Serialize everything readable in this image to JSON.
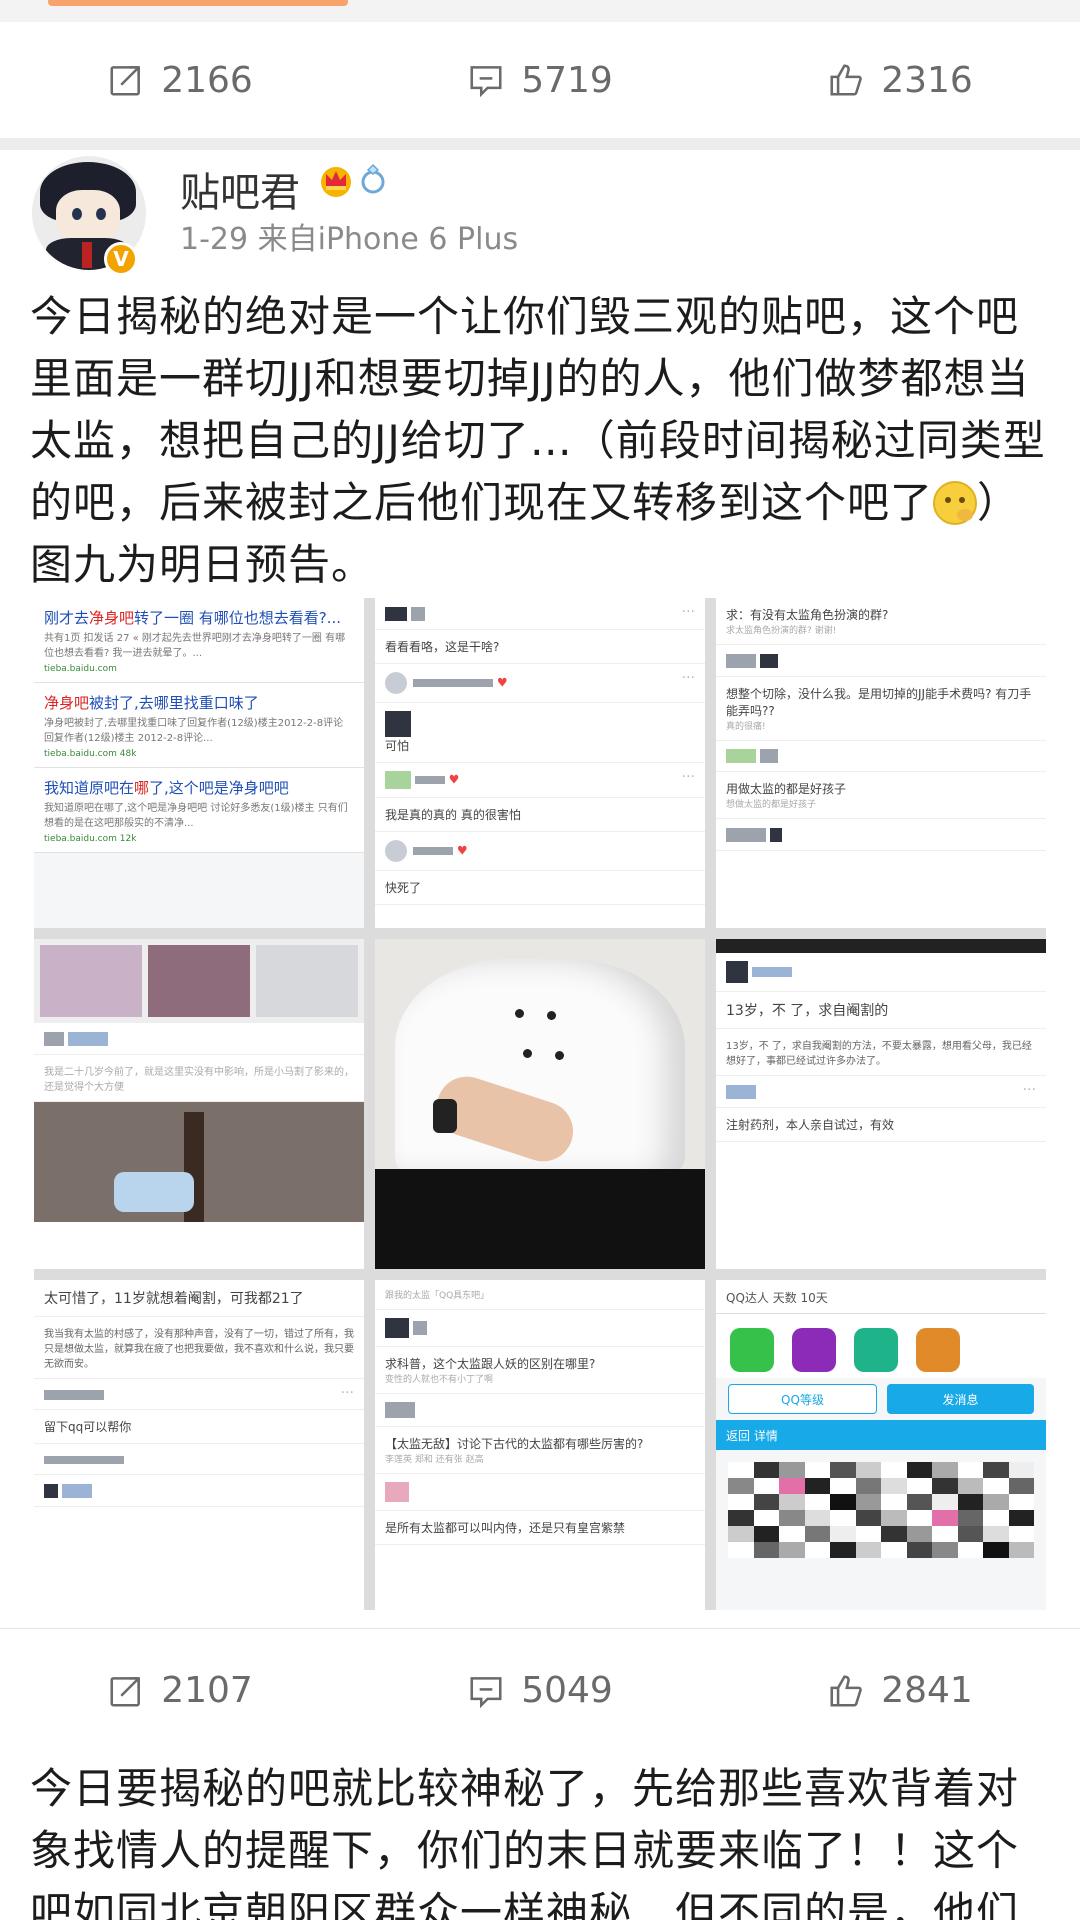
{
  "post1": {
    "stats": {
      "repost": "2166",
      "comment": "5719",
      "like": "2316"
    }
  },
  "author": {
    "name": "贴吧君",
    "meta": "1-29  来自iPhone 6 Plus"
  },
  "post2": {
    "text": "今日揭秘的绝对是一个让你们毁三观的贴吧，这个吧里面是一群切JJ和想要切掉JJ的的人，他们做梦都想当太监，想把自己的JJ给切了…（前段时间揭秘过同类型的吧，后来被封之后他们现在又转移到这个吧了",
    "text_end": "）图九为明日预告。",
    "stats": {
      "repost": "2107",
      "comment": "5049",
      "like": "2841"
    },
    "images": {
      "img1": {
        "results": [
          {
            "title_a": "刚才去",
            "title_hl": "净身吧",
            "title_b": "转了一圈 有哪位也想去看看?...",
            "desc": "共有1页 扣发话 27 « 刚才起先去世界吧刚才去净身吧转了一圈 有哪位也想去看看? 我一进去就晕了。...",
            "url": "tieba.baidu.com"
          },
          {
            "title_a": "",
            "title_hl": "净身吧",
            "title_b": "被封了,去哪里找重口味了",
            "desc": "净身吧被封了,去哪里找重口味了回复作者(12级)楼主2012-2-8评论 回复作者(12级)楼主 2012-2-8评论...",
            "url": "tieba.baidu.com 48k"
          },
          {
            "title_a": "我知道原吧在",
            "title_hl": "哪",
            "title_b": "了,这个吧是净身吧吧",
            "desc": "我知道原吧在哪了,这个吧是净身吧吧 讨论好多悉友(1级)楼主 只有们想看的是在这吧那般实的不清净...",
            "url": "tieba.baidu.com 12k"
          }
        ]
      },
      "img2": {
        "line1": "看看看咯，这是干啥?",
        "line2": "可怕",
        "line3": "我是真的真的 真的很害怕",
        "line4": "快死了"
      },
      "img3": {
        "q1": "求：有没有太监角色扮演的群?",
        "q1b": "求太监角色扮演的群? 谢谢!",
        "q2": "想整个切除，没什么我。是用切掉的JJ能手术费吗? 有刀手能弄吗??",
        "q2b": "真的很痛!",
        "q3": "用做太监的都是好孩子",
        "q3b": "想做太监的都是好孩子"
      },
      "img4": {
        "line1": "我是二十几岁今前了，就是这里实没有中影响，所是小马割了影来的，还是觉得个大方便"
      },
      "img5": {},
      "img6": {
        "title": "13岁，不 了，求自阉割的",
        "body": "13岁，不 了，求自我阉割的方法，不要太暴露，想用看父母，我已经想好了，事都已经试过许多办法了。",
        "reply": "注射药剂，本人亲自试过，有效"
      },
      "img7": {
        "title": "太可惜了，11岁就想着阉割，可我都21了",
        "body": "我当我有太监的村感了，没有那种声音，没有了一切，错过了所有，我只是想做太监，就算我在疲了也把我要做，我不喜欢和什么说，我只要无欲而安。",
        "reply": "留下qq可以帮你"
      },
      "img8": {
        "caption": "跟我的太监「QQ具东吧」",
        "q1": "求科普，这个太监跟人妖的区别在哪里?",
        "q1b": "变性的人就也不有小丁了啊",
        "q2": "【太监无敌】讨论下古代的太监都有哪些厉害的?",
        "q2b": "李莲英 郑和 还有张 赵高",
        "q3": "是所有太监都可以叫内侍，还是只有皇宫紫禁"
      },
      "img9": {
        "top": "QQ达人  天数  10天",
        "btn1": "QQ等级",
        "btn2": "发消息",
        "nav": "返回          详情"
      }
    }
  },
  "post3": {
    "text": "今日要揭秘的吧就比较神秘了，先给那些喜欢背着对象找情人的提醒下，你们的末日就要来临了！！这个吧如同北京朝阳区群众一样神秘…但不同的是，他们是一"
  },
  "colors": {
    "link": "#1f4fb6",
    "highlight": "#dd2222",
    "badge": "#f2a300",
    "muted": "#8a8a8a"
  },
  "icons": [
    "repost-icon",
    "comment-icon",
    "like-icon",
    "crown-icon",
    "ring-icon",
    "verified-icon",
    "emoji-icon"
  ]
}
